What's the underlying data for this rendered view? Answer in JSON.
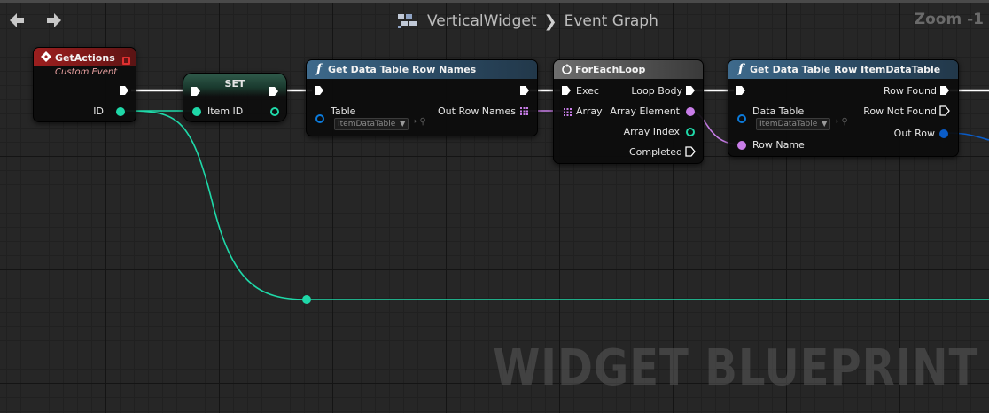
{
  "window": {
    "breadcrumb": [
      "VerticalWidget",
      "Event Graph"
    ],
    "breadcrumb_separator": "❯",
    "zoom": "Zoom -1",
    "watermark": "WIDGET BLUEPRINT"
  },
  "nodes": {
    "get_actions": {
      "title": "GetActions",
      "subtitle": "Custom Event",
      "pins": {
        "id": "ID"
      }
    },
    "set": {
      "title": "SET",
      "pins": {
        "item_id": "Item ID"
      }
    },
    "get_row_names": {
      "title": "Get Data Table Row Names",
      "pins": {
        "table": "Table",
        "out_row_names": "Out Row Names"
      },
      "table_value": "ItemDataTable"
    },
    "for_each": {
      "title": "ForEachLoop",
      "pins": {
        "exec": "Exec",
        "loop_body": "Loop Body",
        "array": "Array",
        "array_element": "Array Element",
        "array_index": "Array Index",
        "completed": "Completed"
      }
    },
    "get_row": {
      "title": "Get Data Table Row ItemDataTable",
      "pins": {
        "data_table": "Data Table",
        "row_name": "Row Name",
        "row_found": "Row Found",
        "row_not_found": "Row Not Found",
        "out_row": "Out Row"
      },
      "table_value": "ItemDataTable"
    }
  },
  "colors": {
    "exec": "#ffffff",
    "name_pin": "#c87de8",
    "int_pin": "#1fd8a8",
    "object_pin": "#0b7bdc",
    "struct_pin": "#0a5cc8",
    "event_header": "#9b1f1f",
    "function_header": "#3e6a8c"
  },
  "icons": {
    "back": "arrow-left-icon",
    "forward": "arrow-right-icon",
    "blueprint": "blueprint-graph-icon",
    "event": "event-diamond-icon",
    "function": "function-f-icon",
    "loop": "loop-icon"
  }
}
